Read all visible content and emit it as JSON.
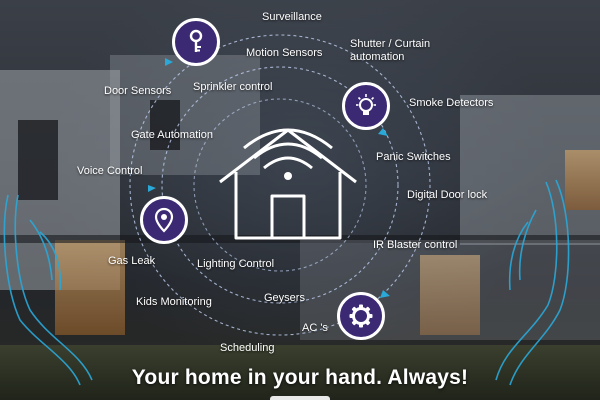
{
  "labels": {
    "surveillance": "Surveillance",
    "motion_sensors": "Motion Sensors",
    "shutter_curtain": "Shutter / Curtain automation",
    "door_sensors": "Door Sensors",
    "sprinkler_control": "Sprinkler control",
    "smoke_detectors": "Smoke Detectors",
    "gate_automation": "Gate Automation",
    "panic_switches": "Panic Switches",
    "voice_control": "Voice Control",
    "digital_door_lock": "Digital Door lock",
    "ir_blaster": "IR Blaster control",
    "gas_leak": "Gas Leak",
    "lighting_control": "Lighting Control",
    "geysers": "Geysers",
    "kids_monitoring": "Kids Monitoring",
    "acs": "AC 's",
    "scheduling": "Scheduling"
  },
  "tagline": "Your home in your hand. Always!",
  "icons": {
    "key": "key-icon",
    "bulb": "light-bulb-icon",
    "location": "location-pin-icon",
    "gear": "gear-icon",
    "home_wifi": "home-wifi-icon"
  },
  "colors": {
    "badge": "#3b2a73",
    "orbit": "#b8c8e8",
    "accent": "#2aa8d8"
  }
}
